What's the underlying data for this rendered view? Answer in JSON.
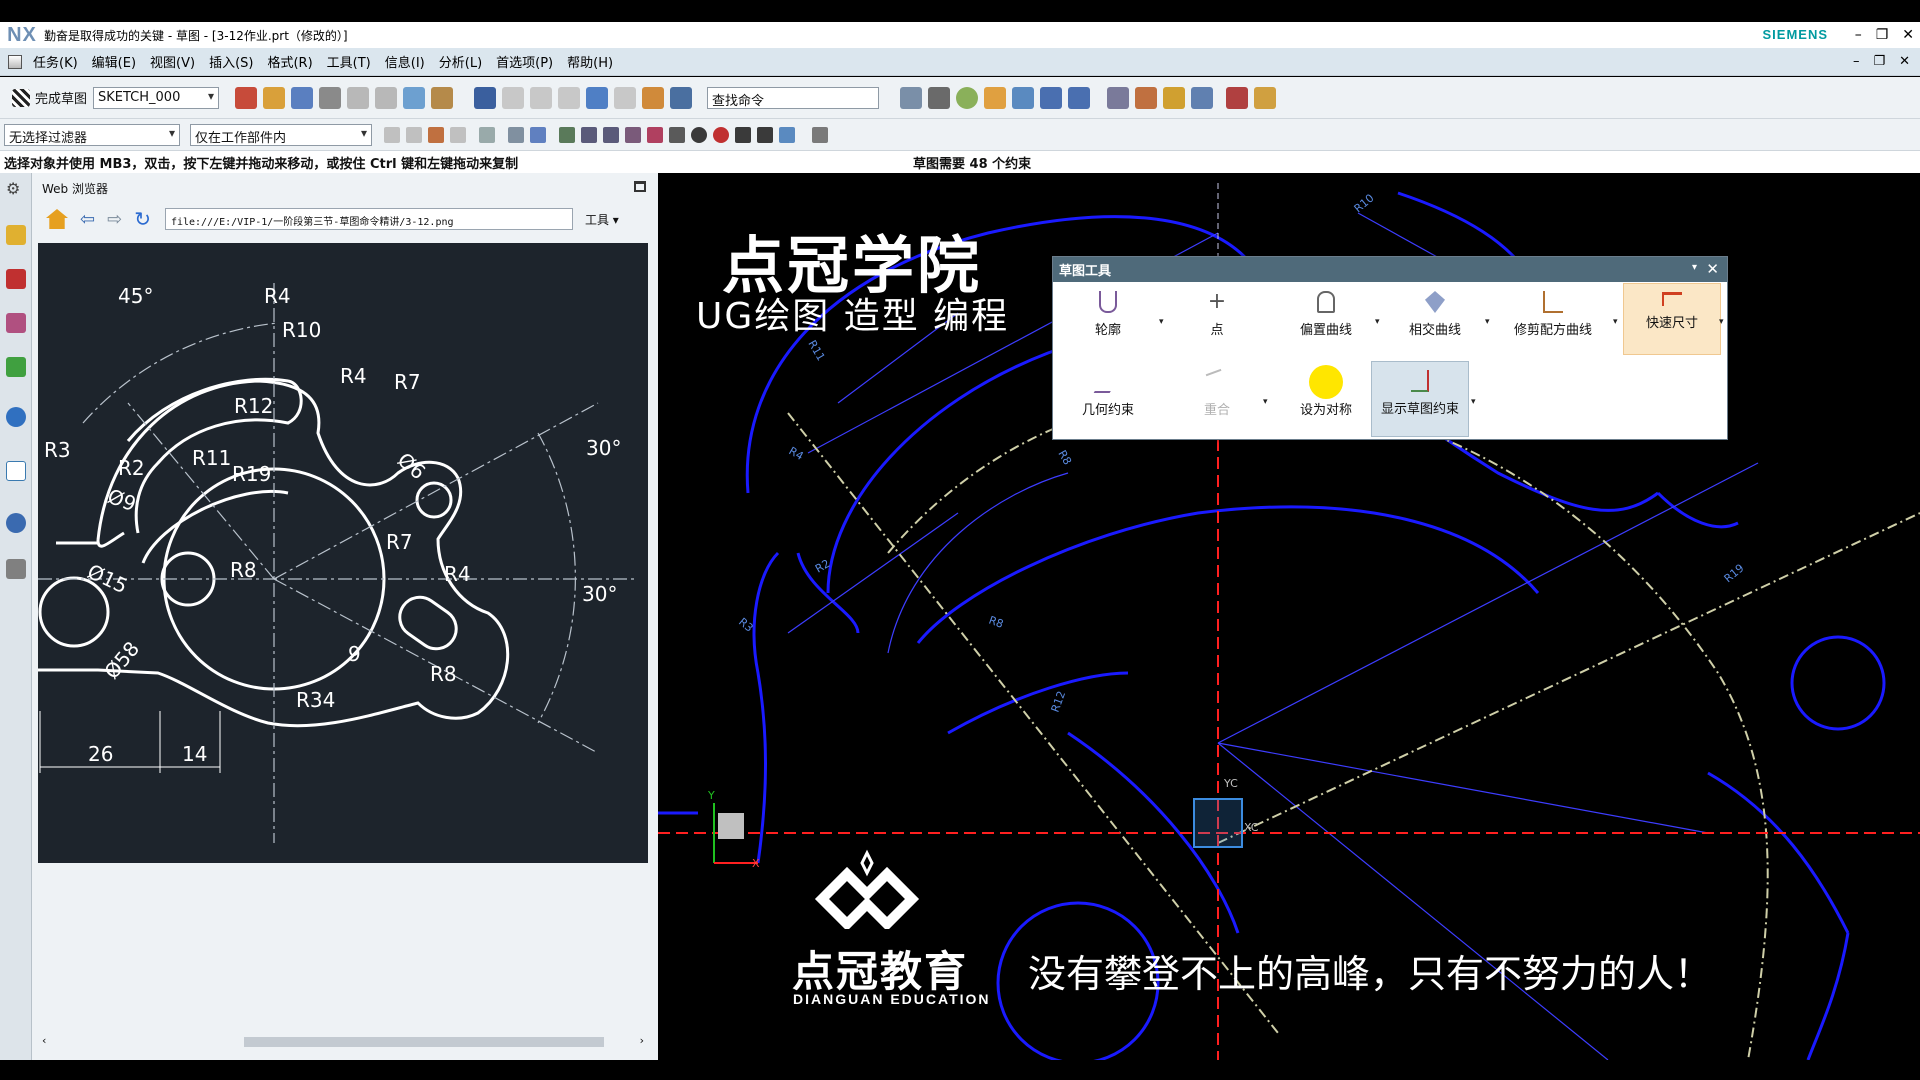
{
  "window": {
    "app_logo": "NX",
    "title": "勤奋是取得成功的关键 - 草图 - [3-12作业.prt（修改的）]",
    "brand": "SIEMENS"
  },
  "menu": [
    "任务(K)",
    "编辑(E)",
    "视图(V)",
    "插入(S)",
    "格式(R)",
    "工具(T)",
    "信息(I)",
    "分析(L)",
    "首选项(P)",
    "帮助(H)"
  ],
  "toolbar": {
    "finish_sketch": "完成草图",
    "sketch_name": "SKETCH_000",
    "search_placeholder": "查找命令"
  },
  "filterbar": {
    "selection_filter": "无选择过滤器",
    "scope": "仅在工作部件内"
  },
  "status": {
    "prompt": "选择对象并使用 MB3，双击，按下左键并拖动来移动，或按住 Ctrl 键和左键拖动来复制",
    "constraints": "草图需要 48 个约束"
  },
  "webbrowser": {
    "title": "Web 浏览器",
    "url": "file:///E:/VIP-1/一阶段第三节-草图命令精讲/3-12.png",
    "tools": "工具",
    "drawing_labels": {
      "a45": "45°",
      "r4a": "R4",
      "r10": "R10",
      "r4b": "R4",
      "r7a": "R7",
      "r12": "R12",
      "r3": "R3",
      "r2": "R2",
      "r11": "R11",
      "r19": "R19",
      "d6": "Ø6",
      "a30a": "30°",
      "d9": "Ø9",
      "r7b": "R7",
      "r8a": "R8",
      "d15": "Ø15",
      "r4c": "R4",
      "a30b": "30°",
      "d58": "Ø58",
      "n9": "9",
      "r8b": "R8",
      "n26": "26",
      "n14": "14",
      "r34": "R34"
    }
  },
  "sketch_tools": {
    "title": "草图工具",
    "row1": [
      "轮廓",
      "点",
      "偏置曲线",
      "相交曲线",
      "修剪配方曲线",
      "快速尺寸"
    ],
    "row2": [
      "几何约束",
      "重合",
      "设为对称",
      "显示草图约束"
    ]
  },
  "overlay": {
    "academy_title": "点冠学院",
    "academy_sub": "UG绘图 造型 编程",
    "edu_name": "点冠教育",
    "edu_en": "DIANGUAN EDUCATION",
    "slogan": "没有攀登不上的高峰，只有不努力的人！"
  },
  "canvas_labels": [
    "R10",
    "R8",
    "R4",
    "R2",
    "R3",
    "R12",
    "R8",
    "R19",
    "R11",
    "YC",
    "XC",
    "X",
    "Y"
  ],
  "colors": {
    "sketch_curve": "#1a1aff",
    "dialog_header": "#4f6a7a",
    "axis": "#ff2020",
    "highlight_btn": "#fbe7c6"
  }
}
